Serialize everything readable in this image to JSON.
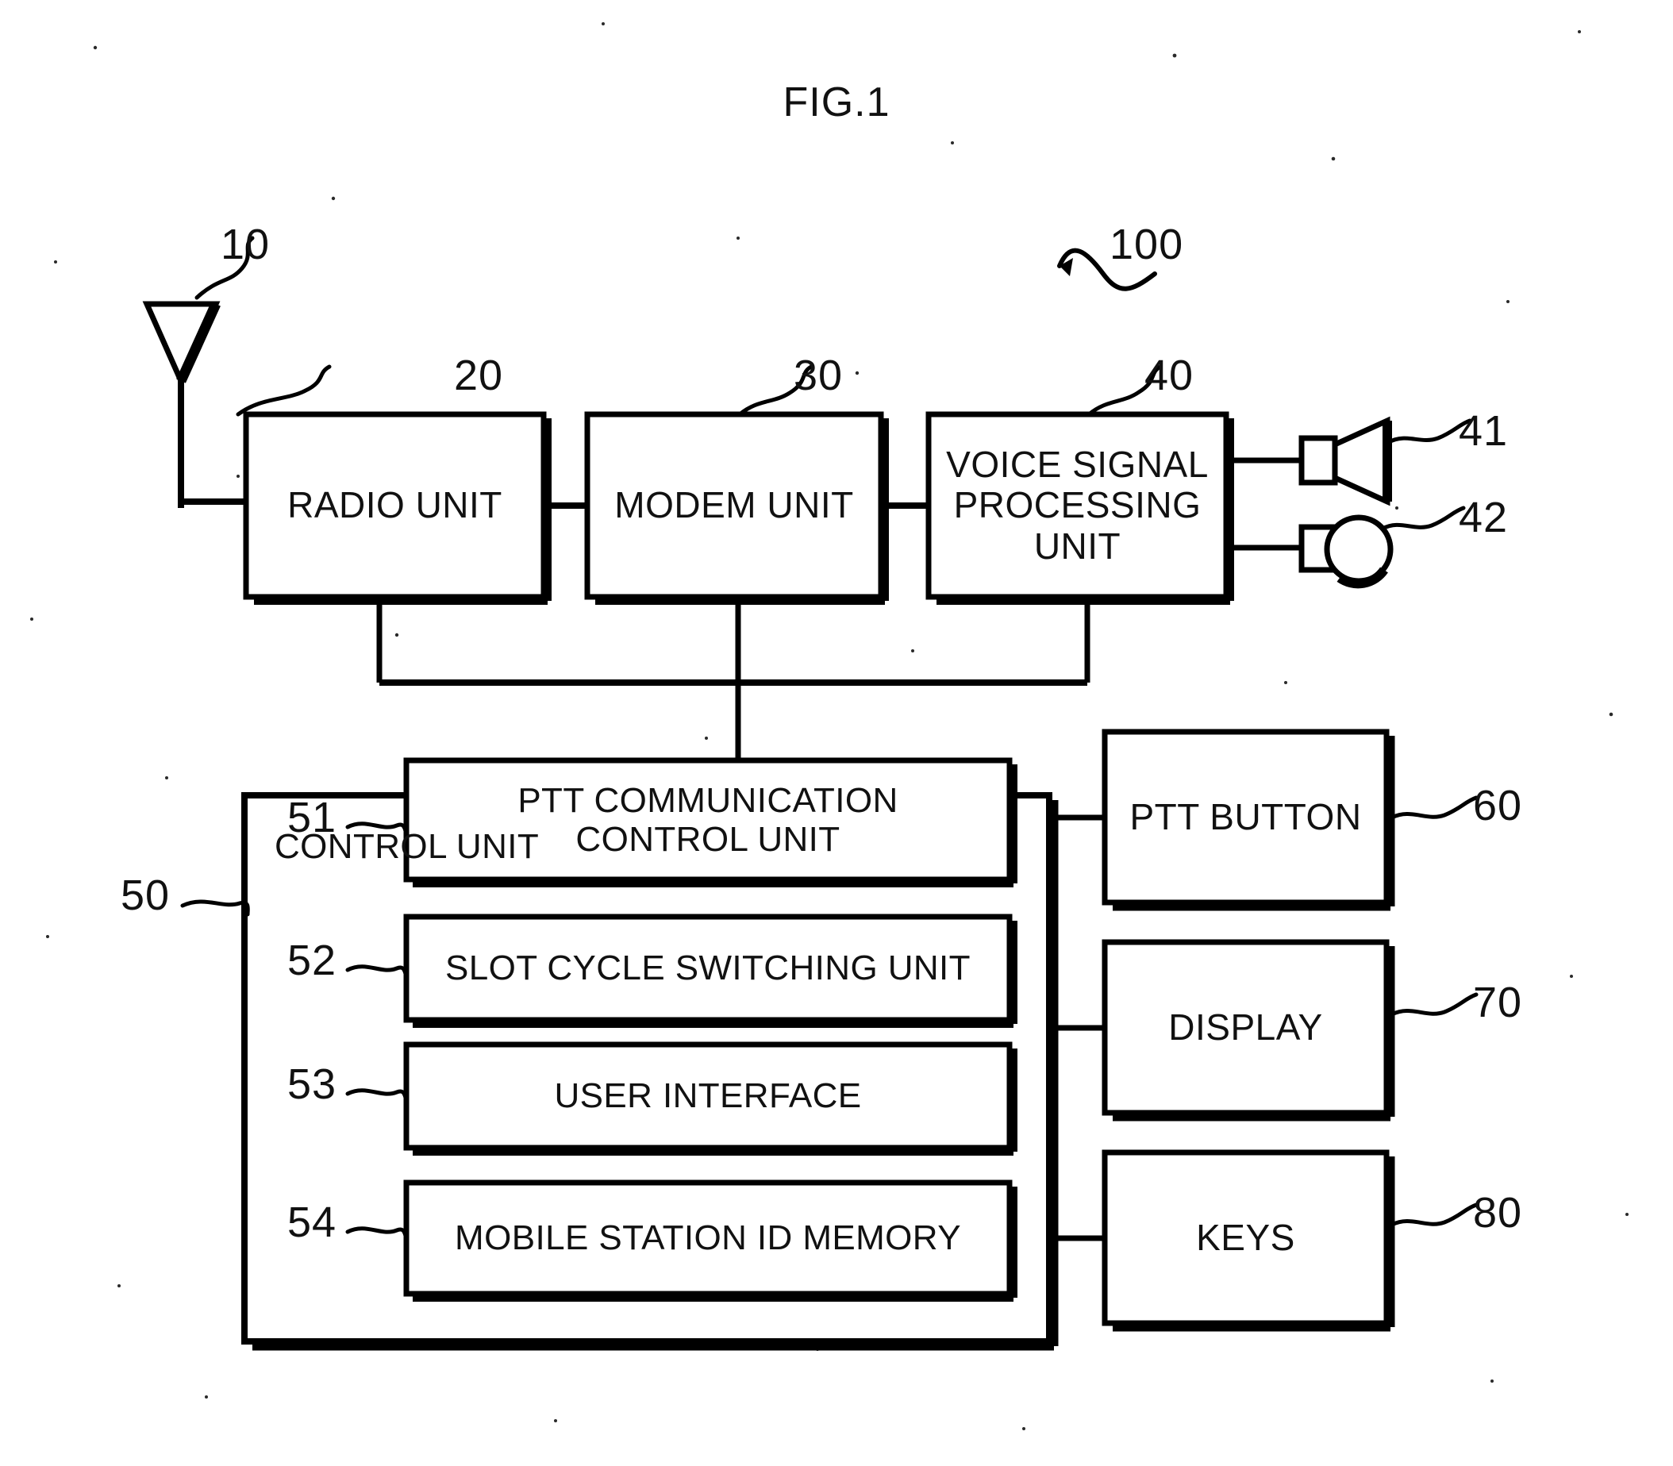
{
  "figure": {
    "title": "FIG.1",
    "system_ref": "100"
  },
  "components": {
    "antenna": {
      "ref": "10",
      "icon": "antenna-icon"
    },
    "radio_unit": {
      "ref": "20",
      "label": "RADIO UNIT"
    },
    "modem_unit": {
      "ref": "30",
      "label": "MODEM UNIT"
    },
    "voice_signal_processing_unit": {
      "ref": "40",
      "label_line1": "VOICE SIGNAL",
      "label_line2": "PROCESSING",
      "label_line3": "UNIT"
    },
    "speaker": {
      "ref": "41",
      "icon": "speaker-icon"
    },
    "microphone": {
      "ref": "42",
      "icon": "microphone-icon"
    },
    "control_unit": {
      "ref": "50",
      "label": "CONTROL UNIT",
      "modules": [
        {
          "ref": "51",
          "label_line1": "PTT COMMUNICATION",
          "label_line2": "CONTROL UNIT"
        },
        {
          "ref": "52",
          "label_line1": "SLOT CYCLE SWITCHING UNIT",
          "label_line2": ""
        },
        {
          "ref": "53",
          "label_line1": "USER INTERFACE",
          "label_line2": ""
        },
        {
          "ref": "54",
          "label_line1": "MOBILE STATION ID MEMORY",
          "label_line2": ""
        }
      ]
    },
    "ptt_button": {
      "ref": "60",
      "label": "PTT BUTTON"
    },
    "display": {
      "ref": "70",
      "label": "DISPLAY"
    },
    "keys": {
      "ref": "80",
      "label": "KEYS"
    }
  },
  "colors": {
    "ink": "#000000",
    "paper": "#ffffff"
  }
}
